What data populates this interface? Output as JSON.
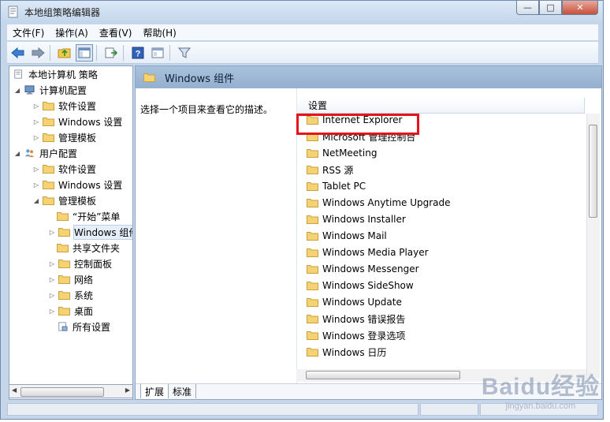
{
  "window": {
    "title": "本地组策略编辑器",
    "controls": [
      "minimize",
      "maximize",
      "close"
    ]
  },
  "menubar": [
    {
      "label": "文件(F)"
    },
    {
      "label": "操作(A)"
    },
    {
      "label": "查看(V)"
    },
    {
      "label": "帮助(H)"
    }
  ],
  "toolbar": {
    "icons": [
      "back-icon",
      "forward-icon",
      "up-folder-icon",
      "show-hide-tree-icon",
      "export-list-icon",
      "help-icon",
      "properties-icon",
      "filter-icon"
    ]
  },
  "tree": {
    "items": [
      {
        "label": "本地计算机 策略"
      },
      {
        "label": "计算机配置"
      },
      {
        "label": "软件设置"
      },
      {
        "label": "Windows 设置"
      },
      {
        "label": "管理模板"
      },
      {
        "label": "用户配置"
      },
      {
        "label": "软件设置"
      },
      {
        "label": "Windows 设置"
      },
      {
        "label": "管理模板"
      },
      {
        "label": "“开始”菜单"
      },
      {
        "label": "Windows 组件"
      },
      {
        "label": "共享文件夹"
      },
      {
        "label": "控制面板"
      },
      {
        "label": "网络"
      },
      {
        "label": "系统"
      },
      {
        "label": "桌面"
      },
      {
        "label": "所有设置"
      }
    ]
  },
  "right_pane": {
    "header_title": "Windows 组件",
    "description": "选择一个项目来查看它的描述。",
    "column_header": "设置",
    "items": [
      {
        "label": "Internet Explorer"
      },
      {
        "label": "Microsoft 管理控制台"
      },
      {
        "label": "NetMeeting"
      },
      {
        "label": "RSS 源"
      },
      {
        "label": "Tablet PC"
      },
      {
        "label": "Windows Anytime Upgrade"
      },
      {
        "label": "Windows Installer"
      },
      {
        "label": "Windows Mail"
      },
      {
        "label": "Windows Media Player"
      },
      {
        "label": "Windows Messenger"
      },
      {
        "label": "Windows SideShow"
      },
      {
        "label": "Windows Update"
      },
      {
        "label": "Windows 错误报告"
      },
      {
        "label": "Windows 登录选项"
      },
      {
        "label": "Windows 日历"
      }
    ],
    "highlighted_item": "Internet Explorer",
    "highlight_color": "#e5141b"
  },
  "tabs": [
    {
      "label": "扩展"
    },
    {
      "label": "标准"
    }
  ],
  "watermark": {
    "logo": "Baidu经验",
    "url": "jingyan.baidu.com"
  },
  "colors": {
    "folder": "#f2c94c",
    "header_bar": "#9fb8d6",
    "selection": "#e6eef9"
  }
}
